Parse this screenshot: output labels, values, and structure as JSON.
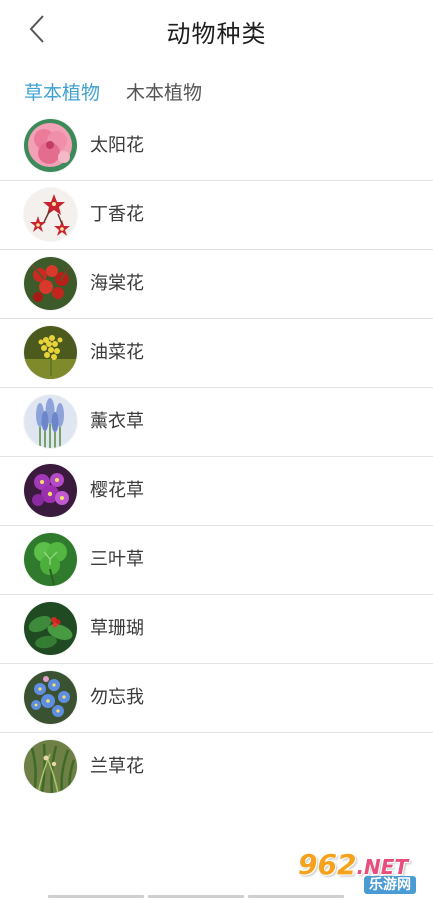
{
  "header": {
    "title": "动物种类",
    "back_icon": "chevron-left-icon"
  },
  "tabs": [
    {
      "label": "草本植物",
      "active": true
    },
    {
      "label": "木本植物",
      "active": false
    }
  ],
  "colors": {
    "accent": "#3fa2d0",
    "divider": "#e3e3e3"
  },
  "items": [
    {
      "label": "太阳花",
      "image": "pink-flower-thumbnail"
    },
    {
      "label": "丁香花",
      "image": "red-clove-flower-thumbnail"
    },
    {
      "label": "海棠花",
      "image": "red-crabapple-thumbnail"
    },
    {
      "label": "油菜花",
      "image": "yellow-rapeseed-thumbnail"
    },
    {
      "label": "薰衣草",
      "image": "lavender-thumbnail"
    },
    {
      "label": "樱花草",
      "image": "purple-primrose-thumbnail"
    },
    {
      "label": "三叶草",
      "image": "clover-thumbnail"
    },
    {
      "label": "草珊瑚",
      "image": "sarcandra-thumbnail"
    },
    {
      "label": "勿忘我",
      "image": "forget-me-not-thumbnail"
    },
    {
      "label": "兰草花",
      "image": "orchid-grass-thumbnail"
    }
  ],
  "watermark": {
    "main": "962",
    "net": ".NET",
    "sub": "乐游网"
  }
}
